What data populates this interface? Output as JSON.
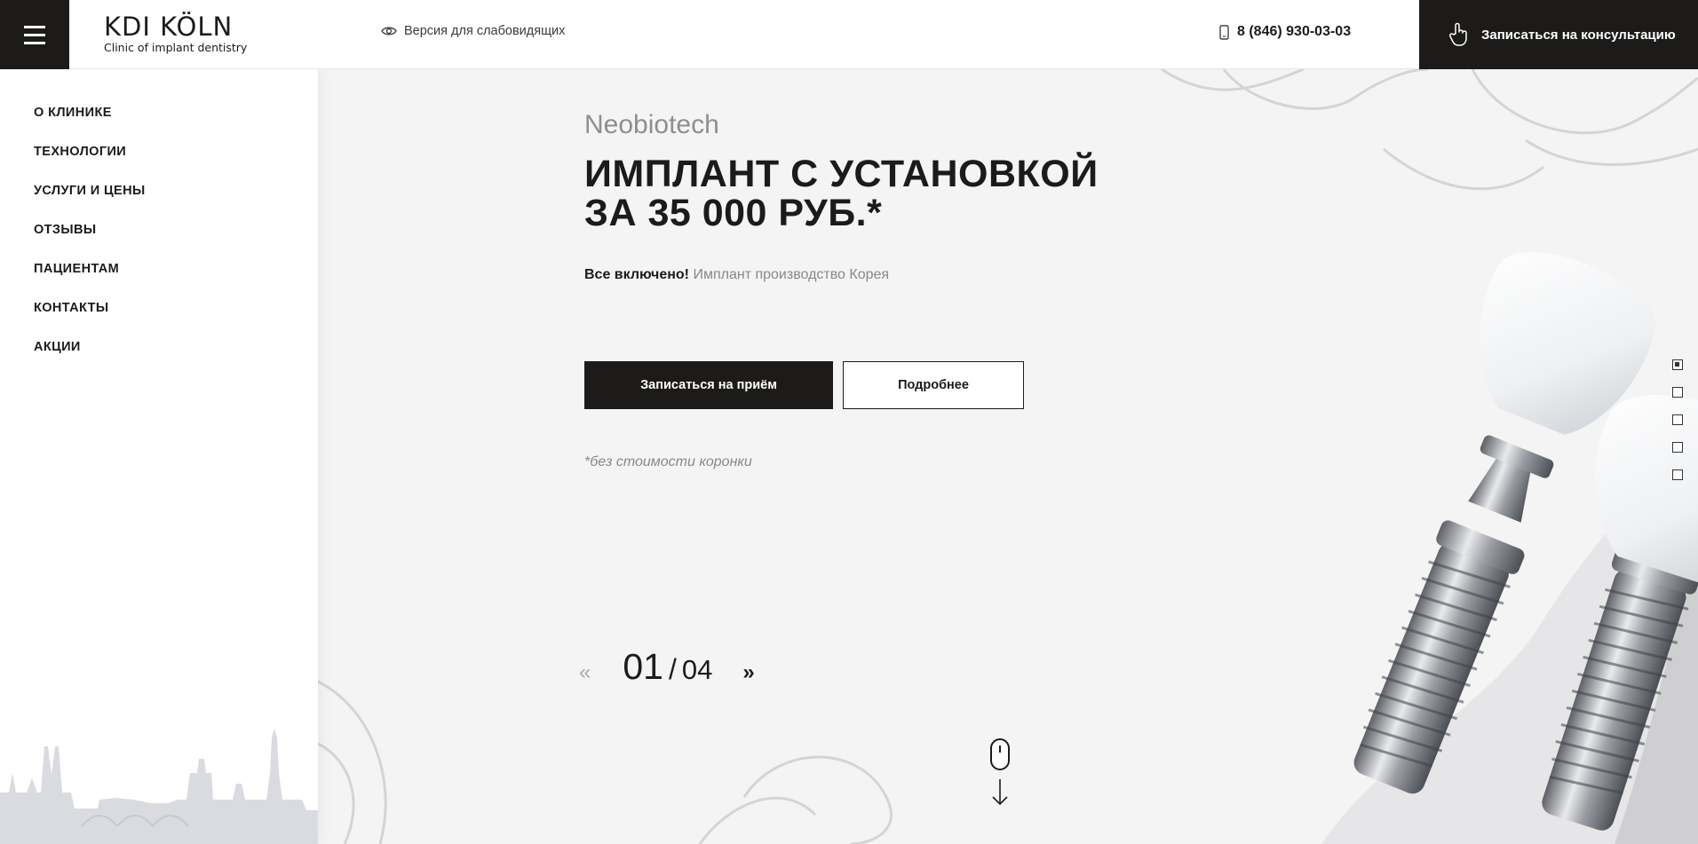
{
  "header": {
    "logo_title": "KDI KÖLN",
    "logo_subtitle": "Clinic of implant dentistry",
    "low_vision_label": "Версия для слабовидящих",
    "phone": "8 (846) 930-03-03",
    "consult_button": "Записаться на консультацию"
  },
  "sidebar": {
    "menu": [
      {
        "label": "О КЛИНИКЕ"
      },
      {
        "label": "ТЕХНОЛОГИИ"
      },
      {
        "label": "УСЛУГИ И ЦЕНЫ"
      },
      {
        "label": "ОТЗЫВЫ"
      },
      {
        "label": "ПАЦИЕНТАМ"
      },
      {
        "label": "КОНТАКТЫ"
      },
      {
        "label": "АКЦИИ"
      }
    ]
  },
  "hero": {
    "brand": "Neobiotech",
    "headline_line1": "ИМПЛАНТ С УСТАНОВКОЙ",
    "headline_line2": "ЗА 35 000 РУБ.*",
    "included_bold": "Все включено!",
    "included_rest": " Имплант производство Корея",
    "primary_button": "Записаться на приём",
    "secondary_button": "Подробнее",
    "footnote": "*без стоимости коронки"
  },
  "pager": {
    "prev": "«",
    "current": "01",
    "separator": "/",
    "total": "04",
    "next": "»"
  },
  "slider_dots": {
    "count": 5,
    "active_index": 0
  },
  "colors": {
    "dark": "#1c1b19",
    "muted_text": "#888888",
    "background": "#f4f4f5"
  },
  "icons": {
    "menu": "hamburger-icon",
    "low_vision": "eye-icon",
    "phone": "phone-icon",
    "consult": "hand-pointer-icon",
    "scroll": "mouse-icon",
    "scroll_arrow": "arrow-down-icon"
  }
}
